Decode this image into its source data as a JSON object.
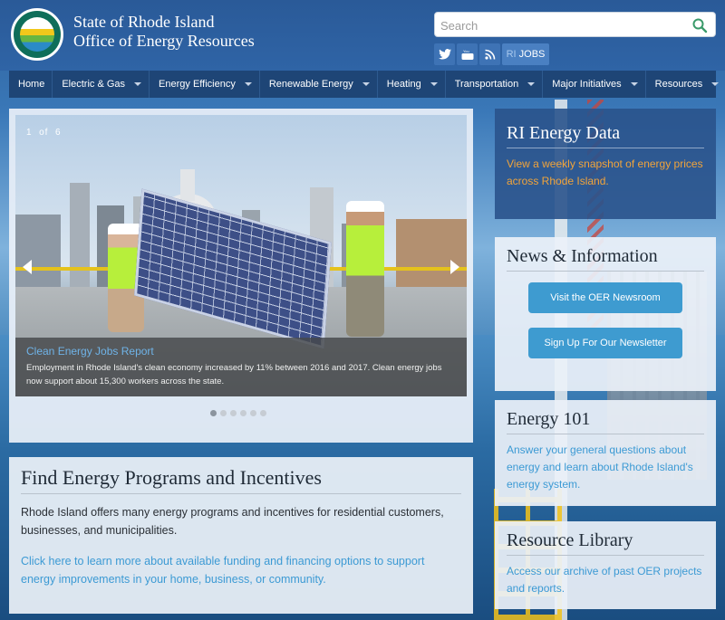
{
  "header": {
    "site_title_line1": "State of Rhode Island",
    "site_title_line2": "Office of Energy Resources",
    "seal_text": "STATE OF RHODE ISLAND · OFFICE OF ENERGY RESOURCES",
    "search_placeholder": "Search",
    "social": {
      "twitter_icon": "twitter-icon",
      "youtube_icon": "youtube-icon",
      "rss_icon": "rss-icon",
      "jobs_prefix": "RI",
      "jobs_label": "JOBS"
    }
  },
  "nav": {
    "items": [
      {
        "label": "Home",
        "dropdown": false
      },
      {
        "label": "Electric & Gas",
        "dropdown": true
      },
      {
        "label": "Energy Efficiency",
        "dropdown": true
      },
      {
        "label": "Renewable Energy",
        "dropdown": true
      },
      {
        "label": "Heating",
        "dropdown": true
      },
      {
        "label": "Transportation",
        "dropdown": true
      },
      {
        "label": "Major Initiatives",
        "dropdown": true
      },
      {
        "label": "Resources",
        "dropdown": true
      }
    ]
  },
  "slider": {
    "counter_current": "1",
    "counter_of": "of",
    "counter_total": "6",
    "caption_title": "Clean Energy Jobs Report",
    "caption_text": "Employment in Rhode Island's clean economy increased by 11% between 2016 and 2017. Clean energy jobs now support about 15,300 workers across the state.",
    "dot_count": 6,
    "active_dot": 1
  },
  "find_energy": {
    "title": "Find Energy Programs and Incentives",
    "text": "Rhode Island offers many energy programs and incentives for residential customers, businesses, and municipalities.",
    "link": "Click here to learn more about available funding and financing options to support energy improvements in your home, business, or community."
  },
  "ri_energy_data": {
    "title": "RI Energy Data",
    "link": "View a weekly snapshot of energy prices across Rhode Island."
  },
  "news": {
    "title": "News & Information",
    "newsroom_button": "Visit the OER Newsroom",
    "newsletter_button": "Sign Up For Our Newsletter"
  },
  "energy_101": {
    "title": "Energy 101",
    "link": "Answer your general questions about energy and learn about Rhode Island's energy system."
  },
  "resource_library": {
    "title": "Resource Library",
    "link": "Access our archive of past OER projects and reports."
  },
  "colors": {
    "header_blue": "#2f64a6",
    "nav_blue": "#1e4576",
    "link_blue": "#3c9ad4",
    "data_orange": "#f2a43a",
    "button_blue": "#3e9bd0"
  }
}
